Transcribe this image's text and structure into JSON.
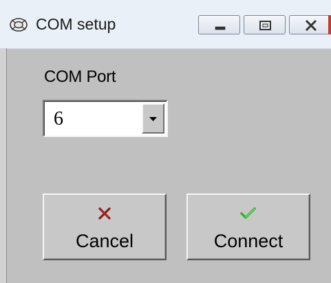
{
  "window": {
    "title": "COM setup",
    "icon": "settings-gear-icon"
  },
  "titlebar": {
    "buttons": [
      "minimize",
      "maximize",
      "close"
    ]
  },
  "form": {
    "com_port_label": "COM Port",
    "com_port_value": "6"
  },
  "actions": {
    "cancel_label": "Cancel",
    "connect_label": "Connect"
  },
  "colors": {
    "window_bg": "#c0c0c0",
    "cancel_icon": "#8b1a1a",
    "connect_icon": "#2fb82f"
  }
}
